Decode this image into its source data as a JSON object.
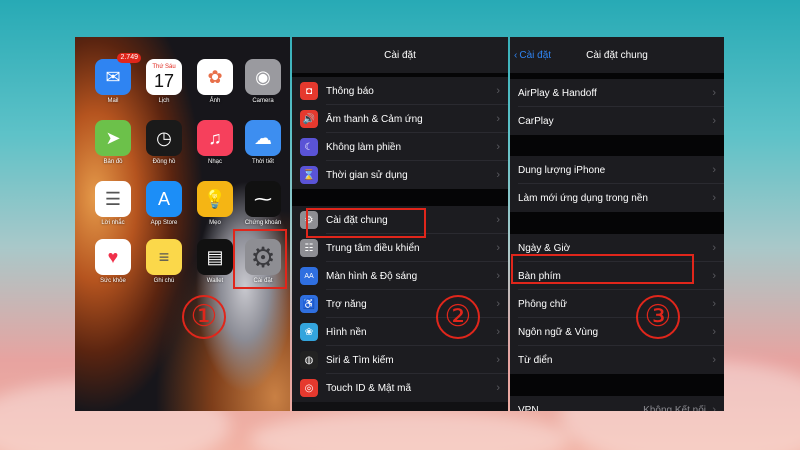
{
  "home": {
    "apps": [
      {
        "label": "Mail",
        "badge": "2.749",
        "color": "#2f84f2",
        "icon": "mail-icon",
        "glyph": "✉"
      },
      {
        "label": "Lịch",
        "day": "Thứ Sáu",
        "date": "17",
        "color": "#ffffff",
        "icon": "calendar-icon"
      },
      {
        "label": "Ảnh",
        "color": "#ffffff",
        "icon": "photos-icon",
        "glyph": "✿"
      },
      {
        "label": "Camera",
        "color": "#9a9a9f",
        "icon": "camera-icon",
        "glyph": "◉"
      },
      {
        "label": "Bản đồ",
        "color": "#6cc14a",
        "icon": "maps-icon",
        "glyph": "➤"
      },
      {
        "label": "Đồng hồ",
        "color": "#1a1a1a",
        "icon": "clock-icon",
        "glyph": "◷"
      },
      {
        "label": "Nhạc",
        "color": "#f6405c",
        "icon": "music-icon",
        "glyph": "♫"
      },
      {
        "label": "Thời tiết",
        "color": "#3d8ef0",
        "icon": "weather-icon",
        "glyph": "☁"
      },
      {
        "label": "Lời nhắc",
        "color": "#ffffff",
        "icon": "reminders-icon",
        "glyph": "☰"
      },
      {
        "label": "App Store",
        "color": "#1c8ef7",
        "icon": "app-store-icon",
        "glyph": "A"
      },
      {
        "label": "Mẹo",
        "color": "#f5b514",
        "icon": "tips-icon",
        "glyph": "💡"
      },
      {
        "label": "Chứng khoán",
        "color": "#111111",
        "icon": "stocks-icon",
        "glyph": "⁓"
      },
      {
        "label": "Sức khỏe",
        "color": "#ffffff",
        "icon": "health-icon",
        "glyph": "♥"
      },
      {
        "label": "Ghi chú",
        "color": "#fbd84a",
        "icon": "notes-icon",
        "glyph": "≡"
      },
      {
        "label": "Wallet",
        "color": "#111111",
        "icon": "wallet-icon",
        "glyph": "▤"
      },
      {
        "label": "Cài đặt",
        "color": "#8e8e93",
        "icon": "settings-gear-icon",
        "glyph": "⚙"
      }
    ],
    "step": "①"
  },
  "settings": {
    "title": "Cài đặt",
    "groups": [
      [
        {
          "label": "Thông báo",
          "color": "#e5392e",
          "icon": "notifications-icon",
          "glyph": "◘"
        },
        {
          "label": "Âm thanh & Cảm ứng",
          "color": "#e5392e",
          "icon": "sound-icon",
          "glyph": "🔊"
        },
        {
          "label": "Không làm phiền",
          "color": "#5a53d6",
          "icon": "do-not-disturb-icon",
          "glyph": "☾"
        },
        {
          "label": "Thời gian sử dụng",
          "color": "#5a53d6",
          "icon": "screen-time-icon",
          "glyph": "⌛"
        }
      ],
      [
        {
          "label": "Cài đặt chung",
          "color": "#8e8e93",
          "icon": "general-icon",
          "glyph": "⚙"
        },
        {
          "label": "Trung tâm điều khiển",
          "color": "#8e8e93",
          "icon": "control-center-icon",
          "glyph": "☷"
        },
        {
          "label": "Màn hình & Độ sáng",
          "color": "#2f6fe0",
          "icon": "display-icon",
          "glyph": "AA"
        },
        {
          "label": "Trợ năng",
          "color": "#2f6fe0",
          "icon": "accessibility-icon",
          "glyph": "♿"
        },
        {
          "label": "Hình nền",
          "color": "#33a4dd",
          "icon": "wallpaper-icon",
          "glyph": "❀"
        },
        {
          "label": "Siri & Tìm kiếm",
          "color": "#222",
          "icon": "siri-icon",
          "glyph": "◍"
        },
        {
          "label": "Touch ID & Mật mã",
          "color": "#e5392e",
          "icon": "touch-id-icon",
          "glyph": "◎"
        }
      ]
    ],
    "step": "②"
  },
  "general": {
    "back": "Cài đặt",
    "title": "Cài đặt chung",
    "groups": [
      [
        {
          "label": "AirPlay & Handoff"
        },
        {
          "label": "CarPlay"
        }
      ],
      [
        {
          "label": "Dung lượng iPhone"
        },
        {
          "label": "Làm mới ứng dụng trong nền"
        }
      ],
      [
        {
          "label": "Ngày & Giờ"
        },
        {
          "label": "Bàn phím"
        },
        {
          "label": "Phông chữ"
        },
        {
          "label": "Ngôn ngữ & Vùng"
        },
        {
          "label": "Từ điển"
        }
      ],
      [
        {
          "label": "VPN",
          "value": "Không Kết nối"
        }
      ]
    ],
    "step": "③"
  },
  "annotation_color": "#e0261b"
}
